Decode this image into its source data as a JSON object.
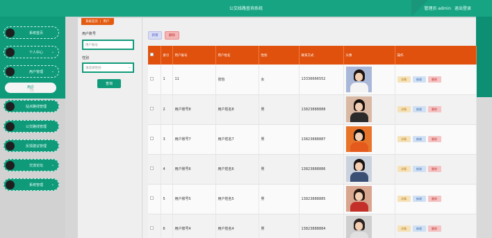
{
  "header": {
    "title": "公交线路查询系统",
    "user_label": "管理员 admin",
    "logout": "退出登录"
  },
  "sidebar": {
    "items": [
      {
        "label": "系统首页",
        "caret": ""
      },
      {
        "label": "个人中心",
        "caret": "⌄"
      },
      {
        "label": "用户管理",
        "caret": "⌄"
      },
      {
        "label": "站点路线管理",
        "caret": ""
      },
      {
        "label": "公交路线管理",
        "caret": ""
      },
      {
        "label": "反馈建议管理",
        "caret": ""
      },
      {
        "label": "交流论坛",
        "caret": "⌄"
      },
      {
        "label": "系统管理",
        "caret": "⌄"
      }
    ],
    "sub_active": "用户"
  },
  "breadcrumb": {
    "home": "系统首页",
    "current": "用户"
  },
  "filters": {
    "account_label": "用户账号",
    "account_placeholder": "用户账号",
    "gender_label": "性别",
    "gender_placeholder": "请选择性别",
    "search_button": "查询"
  },
  "actions": {
    "add": "新增",
    "delete": "删除"
  },
  "table": {
    "headers": [
      "",
      "索引",
      "用户账号",
      "用户姓名",
      "性别",
      "联系方式",
      "头像",
      "操作"
    ],
    "op_labels": {
      "detail": "详情",
      "edit": "修改",
      "delete": "删除"
    },
    "rows": [
      {
        "index": "1",
        "account": "11",
        "name": "张怡",
        "gender": "女",
        "phone": "13336666552",
        "avatar": {
          "bg": "#a9b8d8",
          "hair": "#1d1410",
          "body": "#f3f3f3"
        }
      },
      {
        "index": "2",
        "account": "用户账号8",
        "name": "用户姓名8",
        "gender": "男",
        "phone": "13823888888",
        "avatar": {
          "bg": "#d9b9a4",
          "hair": "#1a1210",
          "body": "#2b2b2b"
        }
      },
      {
        "index": "3",
        "account": "用户账号7",
        "name": "用户姓名7",
        "gender": "男",
        "phone": "13823888887",
        "avatar": {
          "bg": "#e8742a",
          "hair": "#151010",
          "body": "#e45a1d"
        }
      },
      {
        "index": "4",
        "account": "用户账号6",
        "name": "用户姓名6",
        "gender": "男",
        "phone": "13823888886",
        "avatar": {
          "bg": "#c9d2dd",
          "hair": "#1a1414",
          "body": "#3a4f74"
        }
      },
      {
        "index": "5",
        "account": "用户账号5",
        "name": "用户姓名5",
        "gender": "男",
        "phone": "13823888885",
        "avatar": {
          "bg": "#d8a58e",
          "hair": "#2a1a14",
          "body": "#c3302a"
        }
      },
      {
        "index": "6",
        "account": "用户账号4",
        "name": "用户姓名4",
        "gender": "男",
        "phone": "13823888884",
        "avatar": {
          "bg": "#cfcfcf",
          "hair": "#2b2220",
          "body": "#e0e0e0"
        }
      }
    ]
  }
}
